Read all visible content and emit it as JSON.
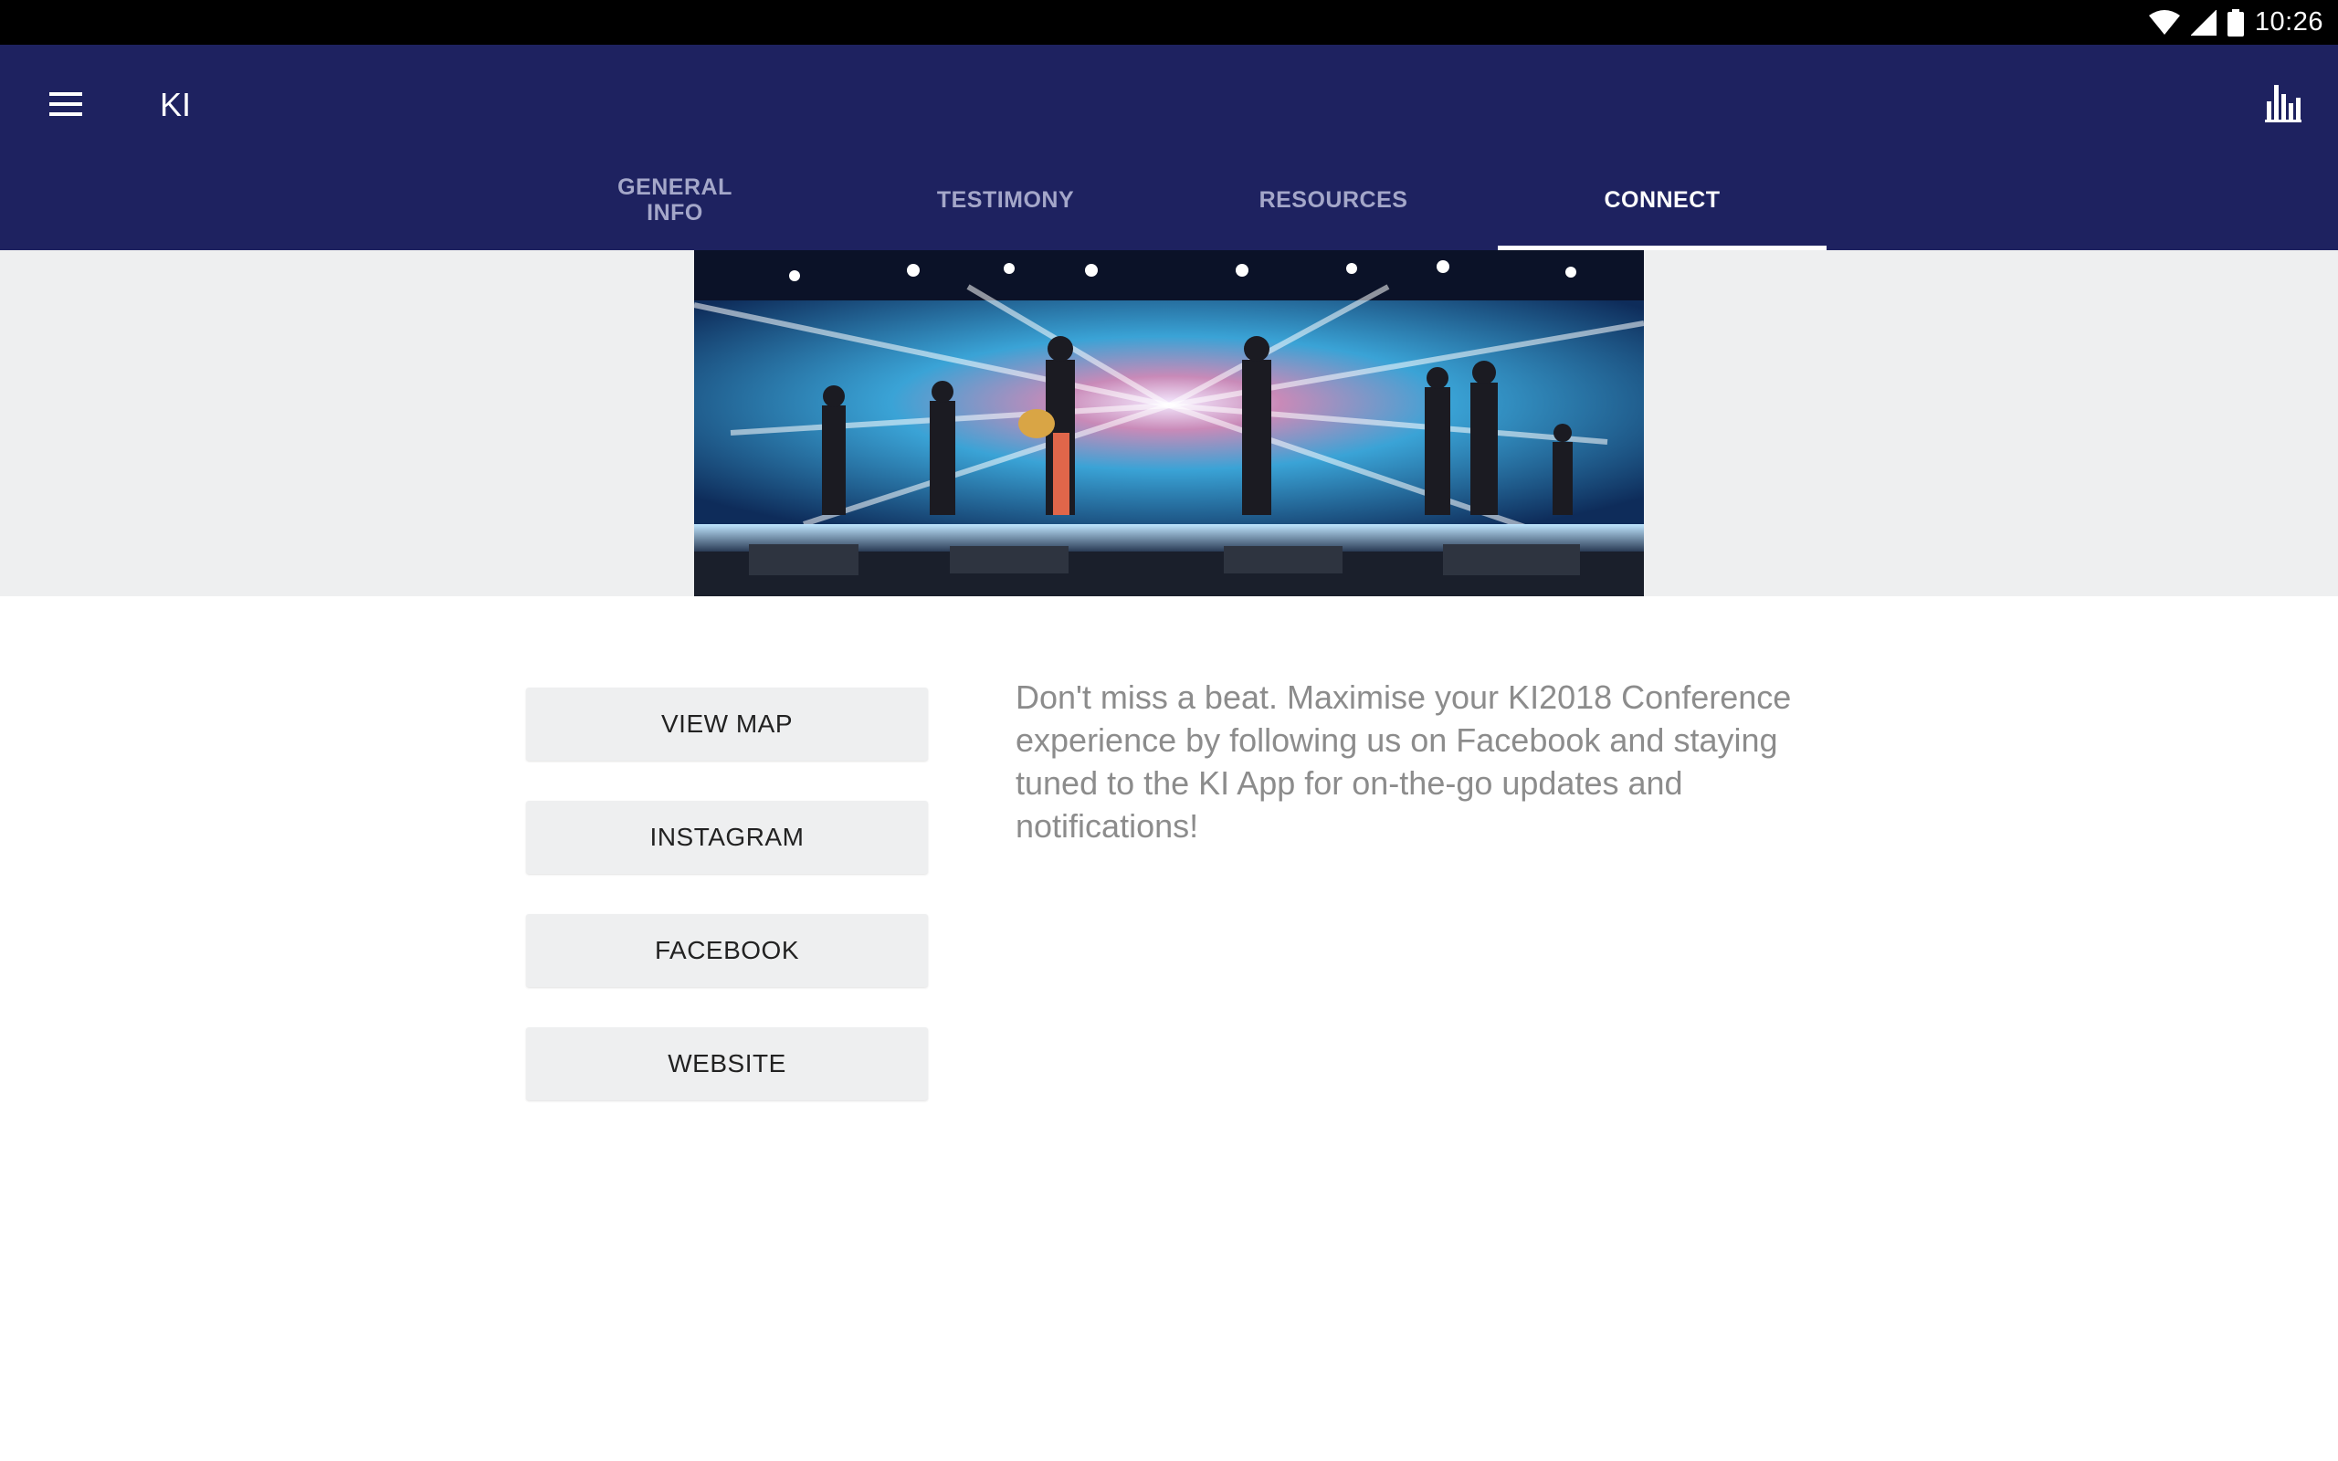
{
  "status_bar": {
    "time": "10:26",
    "icons": [
      "wifi-icon",
      "cell-signal-icon",
      "battery-icon"
    ]
  },
  "app_bar": {
    "title": "KI",
    "menu_icon": "hamburger-menu-icon",
    "action_icon": "bar-chart-icon",
    "background": "#1e2260"
  },
  "tabs": [
    {
      "label": "GENERAL\nINFO",
      "active": false
    },
    {
      "label": "TESTIMONY",
      "active": false
    },
    {
      "label": "RESOURCES",
      "active": false
    },
    {
      "label": "CONNECT",
      "active": true
    }
  ],
  "banner": {
    "image": "worship band performing on stage with stage lights"
  },
  "buttons": {
    "view_map": "VIEW MAP",
    "instagram": "INSTAGRAM",
    "facebook": "FACEBOOK",
    "website": "WEBSITE"
  },
  "description": "Don't miss a beat. Maximise your KI2018 Conference experience by following us on Facebook and staying tuned to the KI App for on-the-go updates and notifications!"
}
